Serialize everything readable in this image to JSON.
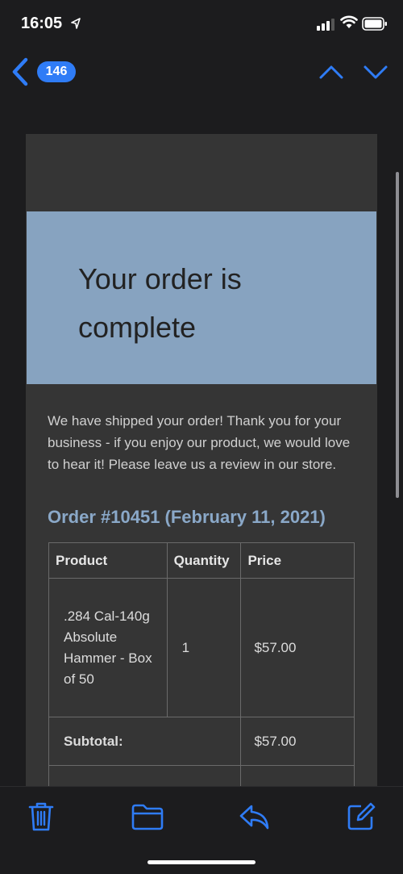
{
  "status_bar": {
    "time": "16:05"
  },
  "nav": {
    "unread_count": "146"
  },
  "email": {
    "hero_title": "Your order is complete",
    "intro": "We have shipped your order! Thank you for your business - if you enjoy our product, we would love to hear it! Please leave us a review in our store.",
    "order_heading": "Order #10451 (February 11, 2021)",
    "table": {
      "headers": [
        "Product",
        "Quantity",
        "Price"
      ],
      "item": {
        "product": ".284 Cal-140g Absolute Hammer - Box of 50",
        "quantity": "1",
        "price": "$57.00"
      },
      "subtotal_label": "Subtotal:",
      "subtotal_value": "$57.00"
    }
  },
  "icons": {
    "accent": "#2f7cf6"
  }
}
